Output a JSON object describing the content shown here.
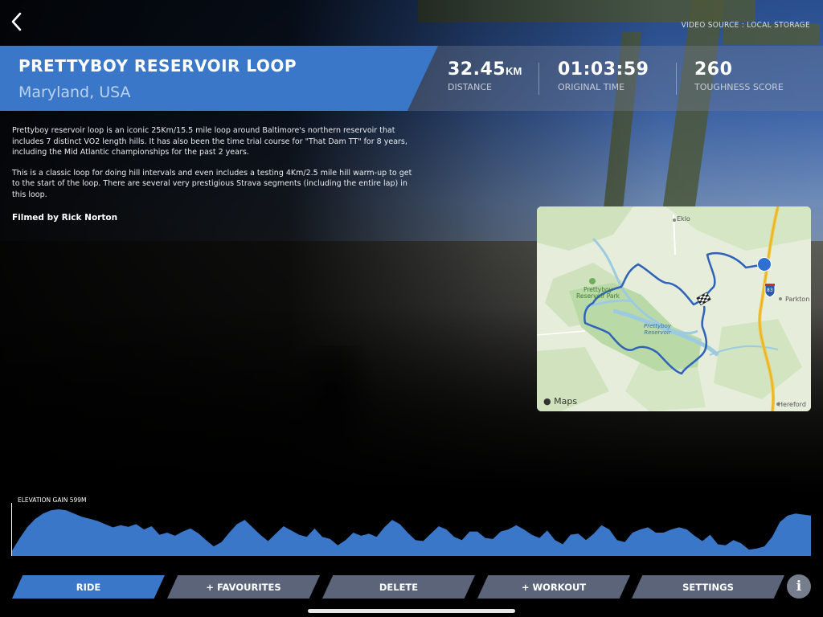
{
  "header": {
    "back_icon": "chevron-left-icon",
    "video_source": "VIDEO SOURCE : LOCAL STORAGE"
  },
  "route": {
    "title": "PRETTYBOY RESERVOIR LOOP",
    "location": "Maryland, USA"
  },
  "stats": [
    {
      "value": "32.45",
      "unit": "KM",
      "label": "DISTANCE"
    },
    {
      "value": "01:03:59",
      "unit": "",
      "label": "ORIGINAL TIME"
    },
    {
      "value": "260",
      "unit": "",
      "label": "TOUGHNESS SCORE"
    }
  ],
  "description": {
    "paragraphs": [
      "Prettyboy reservoir loop is an iconic 25Km/15.5 mile loop around Baltimore's northern reservoir that includes 7 distinct VO2 length hills. It has also been the time trial course for \"That Dam TT\" for 8 years, including the Mid Atlantic championships for the past 2 years.",
      "This is a classic loop for doing hill intervals and even includes a testing 4Km/2.5 mile hill warm-up to get to the start of the loop. There are several very prestigious Strava segments (including the entire lap) in this loop."
    ],
    "filmed_by": "Filmed by Rick Norton"
  },
  "map": {
    "labels": {
      "eklo": "Eklo",
      "park": "Prettyboy Reservoir Park",
      "reservoir": "Prettyboy Reservoir",
      "parkton": "Parkton",
      "hereford": "Hereford",
      "interstate": "83"
    },
    "brand": "Maps",
    "route_color": "#2f63b8",
    "start_marker_color": "#2f6fd1"
  },
  "elevation": {
    "label": "ELEVATION GAIN 599M",
    "fill_color": "#3a77c9",
    "profile": [
      0.1,
      0.34,
      0.55,
      0.7,
      0.8,
      0.86,
      0.88,
      0.86,
      0.8,
      0.74,
      0.7,
      0.66,
      0.6,
      0.54,
      0.58,
      0.55,
      0.6,
      0.5,
      0.56,
      0.4,
      0.44,
      0.38,
      0.46,
      0.52,
      0.43,
      0.3,
      0.18,
      0.26,
      0.44,
      0.6,
      0.68,
      0.54,
      0.4,
      0.28,
      0.42,
      0.56,
      0.48,
      0.4,
      0.36,
      0.52,
      0.36,
      0.32,
      0.2,
      0.3,
      0.44,
      0.38,
      0.42,
      0.36,
      0.54,
      0.68,
      0.6,
      0.44,
      0.3,
      0.28,
      0.42,
      0.56,
      0.5,
      0.36,
      0.3,
      0.46,
      0.46,
      0.34,
      0.32,
      0.46,
      0.5,
      0.58,
      0.5,
      0.4,
      0.34,
      0.48,
      0.3,
      0.22,
      0.4,
      0.42,
      0.3,
      0.42,
      0.58,
      0.5,
      0.3,
      0.26,
      0.44,
      0.5,
      0.54,
      0.44,
      0.44,
      0.5,
      0.54,
      0.5,
      0.38,
      0.28,
      0.4,
      0.22,
      0.2,
      0.3,
      0.24,
      0.12,
      0.14,
      0.18,
      0.36,
      0.64,
      0.76,
      0.8,
      0.78,
      0.76
    ]
  },
  "nav": {
    "ride": "RIDE",
    "favourites": "+ FAVOURITES",
    "delete": "DELETE",
    "workout": "+ WORKOUT",
    "settings": "SETTINGS",
    "info": "i"
  },
  "colors": {
    "accent": "#3a77c9",
    "button": "#5b6479"
  }
}
